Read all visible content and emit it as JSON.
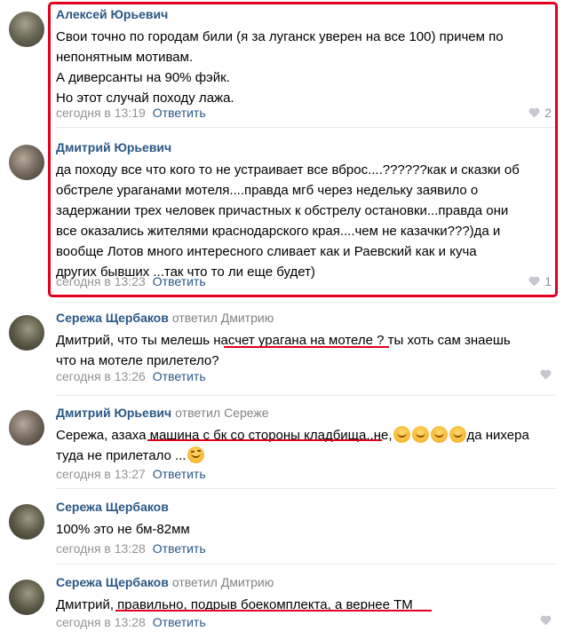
{
  "comments": [
    {
      "author": "Алексей Юрьевич",
      "reply_to": "",
      "reply_name": "",
      "lines": [
        "Свои точно по городам били (я за луганск уверен на все 100) причем по",
        "непонятным мотивам.",
        "А диверсанты на 90% фэйк.",
        "Но этот случай походу лажа."
      ],
      "time": "сегодня в 13:19",
      "reply_label": "Ответить",
      "likes": "2"
    },
    {
      "author": "Дмитрий Юрьевич",
      "reply_to": "",
      "reply_name": "",
      "lines": [
        "да походу все что кого то не устраивает все вброс....??????как и сказки об",
        "обстреле ураганами мотеля....правда мгб через недельку заявило о",
        "задержании трех человек причастных к обстрелу остановки...правда они",
        "все оказались жителями краснодарского края....чем не казачки???)да и",
        "вообще Лотов много интересного сливает как и Раевский как и куча",
        "других бывших ...так что то ли еще будет)"
      ],
      "time": "сегодня в 13:23",
      "reply_label": "Ответить",
      "likes": "1"
    },
    {
      "author": "Сережа Щербаков",
      "reply_to": "ответил",
      "reply_name": "Дмитрию",
      "lines": [
        "Дмитрий, что ты мелешь насчет урагана на мотеле ? ты хоть сам знаешь",
        "что на мотеле прилетело?"
      ],
      "time": "сегодня в 13:26",
      "reply_label": "Ответить",
      "likes": ""
    },
    {
      "author": "Дмитрий Юрьевич",
      "reply_to": "ответил",
      "reply_name": "Сереже",
      "line1_text": "Сережа, азаха машина с бк со стороны кладбища..не,",
      "line1_tail": "да нихера",
      "line2_text": "туда не прилетало ...",
      "time": "сегодня в 13:27",
      "reply_label": "Ответить",
      "likes": ""
    },
    {
      "author": "Сережа Щербаков",
      "reply_to": "",
      "reply_name": "",
      "lines": [
        "100% это не бм-82мм"
      ],
      "time": "сегодня в 13:28",
      "reply_label": "Ответить",
      "likes": ""
    },
    {
      "author": "Сережа Щербаков",
      "reply_to": "ответил",
      "reply_name": "Дмитрию",
      "lines": [
        "Дмитрий, правильно, подрыв боекомплекта, а вернее ТМ"
      ],
      "time": "сегодня в 13:28",
      "reply_label": "Ответить",
      "likes": ""
    }
  ],
  "colors": {
    "author": "#2a5885",
    "meta": "#939393",
    "highlight": "#e0001b"
  },
  "icons": {
    "like": "heart-icon",
    "emoji": "smiley-emoji",
    "wink": "wink-emoji"
  }
}
